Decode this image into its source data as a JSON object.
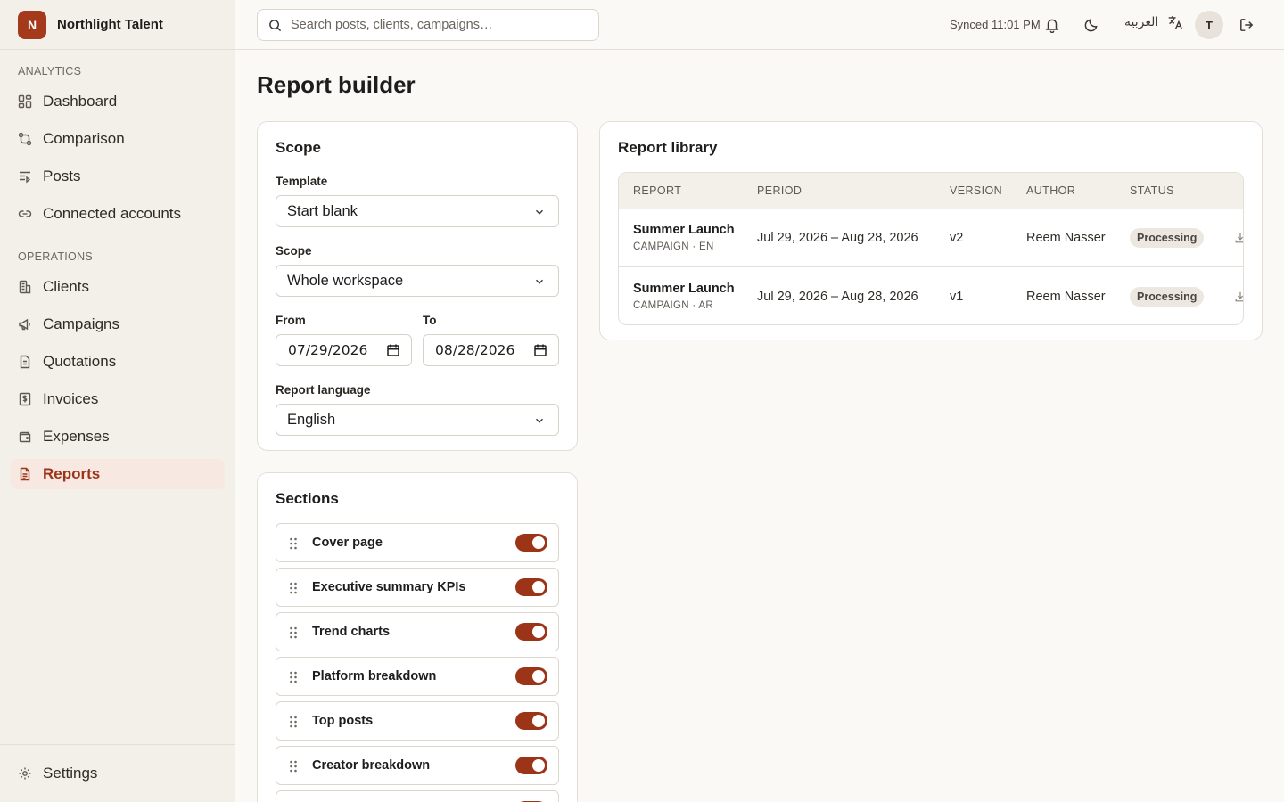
{
  "brand": {
    "logo_letter": "N",
    "name": "Northlight Talent",
    "accent": "#a5391c"
  },
  "sidebar": {
    "groups": [
      {
        "title": "ANALYTICS",
        "items": [
          {
            "label": "Dashboard",
            "icon": "dashboard-icon"
          },
          {
            "label": "Comparison",
            "icon": "compare-icon"
          },
          {
            "label": "Posts",
            "icon": "posts-icon"
          },
          {
            "label": "Connected accounts",
            "icon": "link-icon"
          }
        ]
      },
      {
        "title": "OPERATIONS",
        "items": [
          {
            "label": "Clients",
            "icon": "building-icon"
          },
          {
            "label": "Campaigns",
            "icon": "megaphone-icon"
          },
          {
            "label": "Quotations",
            "icon": "document-icon"
          },
          {
            "label": "Invoices",
            "icon": "receipt-icon"
          },
          {
            "label": "Expenses",
            "icon": "wallet-icon"
          },
          {
            "label": "Reports",
            "icon": "report-icon",
            "active": true
          }
        ]
      }
    ],
    "settings_label": "Settings"
  },
  "topbar": {
    "search_placeholder": "Search posts, clients, campaigns…",
    "synced_text": "Synced 11:01 PM",
    "language_label": "العربية",
    "avatar_initial": "T"
  },
  "page": {
    "title": "Report builder"
  },
  "scope_card": {
    "title": "Scope",
    "template_label": "Template",
    "template_value": "Start blank",
    "scope_label": "Scope",
    "scope_value": "Whole workspace",
    "from_label": "From",
    "from_value": "07/29/2026",
    "to_label": "To",
    "to_value": "08/28/2026",
    "language_label": "Report language",
    "language_value": "English"
  },
  "sections_card": {
    "title": "Sections",
    "items": [
      {
        "label": "Cover page",
        "enabled": true
      },
      {
        "label": "Executive summary KPIs",
        "enabled": true
      },
      {
        "label": "Trend charts",
        "enabled": true
      },
      {
        "label": "Platform breakdown",
        "enabled": true
      },
      {
        "label": "Top posts",
        "enabled": true
      },
      {
        "label": "Creator breakdown",
        "enabled": true
      }
    ]
  },
  "library": {
    "title": "Report library",
    "columns": [
      "REPORT",
      "PERIOD",
      "VERSION",
      "AUTHOR",
      "STATUS"
    ],
    "rows": [
      {
        "name": "Summer Launch",
        "sub": "CAMPAIGN · EN",
        "period": "Jul 29, 2026 – Aug 28, 2026",
        "version": "v2",
        "author": "Reem Nasser",
        "status": "Processing"
      },
      {
        "name": "Summer Launch",
        "sub": "CAMPAIGN · AR",
        "period": "Jul 29, 2026 – Aug 28, 2026",
        "version": "v1",
        "author": "Reem Nasser",
        "status": "Processing"
      }
    ]
  },
  "colors": {
    "accent": "#9c3418",
    "sidebar_bg": "#f3efe9",
    "page_bg": "#fbf9f6",
    "active_nav_bg": "#f7e8e1"
  }
}
